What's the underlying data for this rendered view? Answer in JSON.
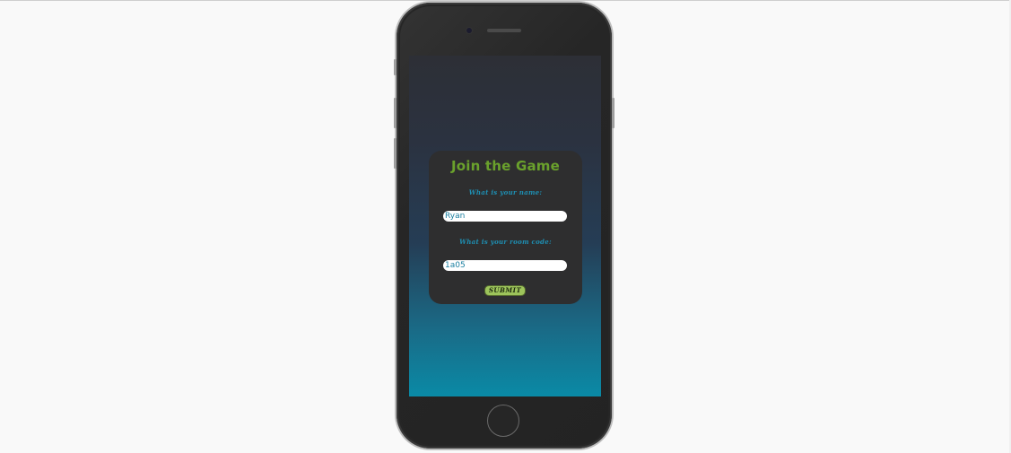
{
  "join_form": {
    "title": "Join the Game",
    "name_label": "What is your name:",
    "name_value": "Ryan",
    "room_label": "What is your room code:",
    "room_value": "1a05",
    "submit_label": "SUBMIT"
  },
  "colors": {
    "title": "#6aa12c",
    "label": "#1e8fb3",
    "submit_bg": "#9dc45b",
    "card_bg": "#2e2e2f",
    "screen_top": "#2d2f36",
    "screen_bottom": "#0a8aa6"
  }
}
